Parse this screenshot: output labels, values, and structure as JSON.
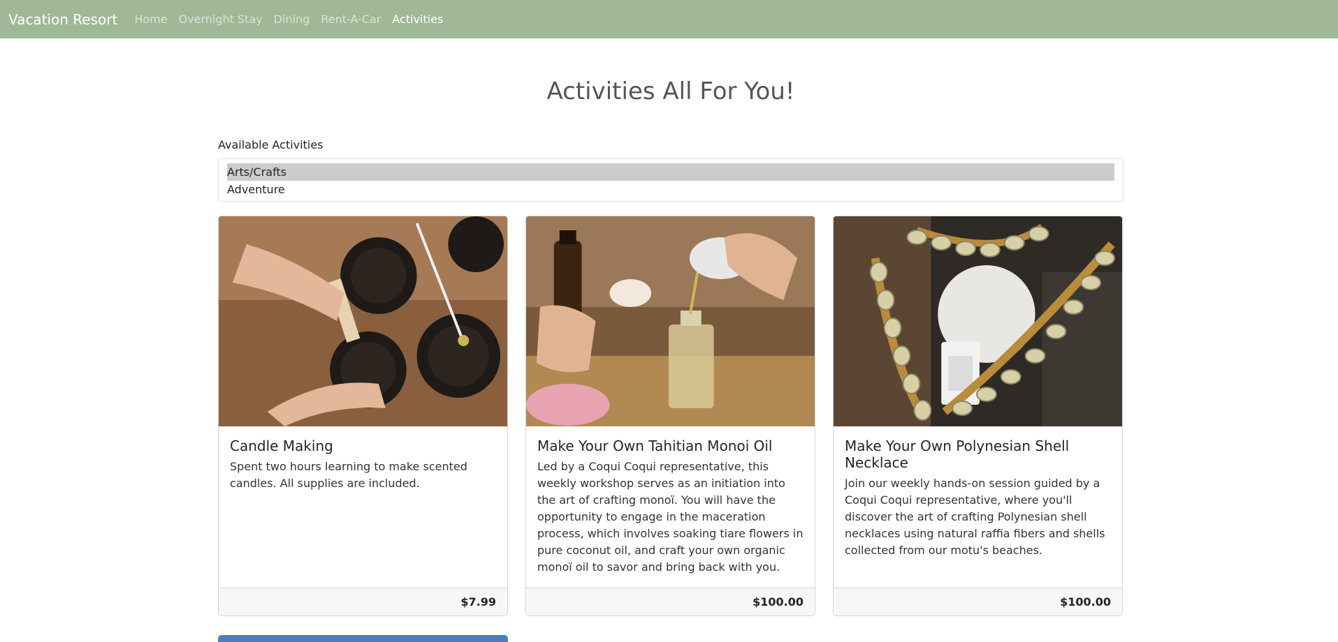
{
  "nav": {
    "brand": "Vacation Resort",
    "links": [
      "Home",
      "Overnight Stay",
      "Dining",
      "Rent-A-Car",
      "Activities"
    ]
  },
  "main": {
    "title": "Activities All For You!",
    "select_label": "Available Activities",
    "options": [
      "Arts/Crafts",
      "Adventure"
    ],
    "selected": "Arts/Crafts"
  },
  "cards": [
    {
      "title": "Candle Making",
      "text": "Spent two hours learning to make scented candles. All supplies are included.",
      "price": "$7.99"
    },
    {
      "title": "Make Your Own Tahitian Monoi Oil",
      "text": "Led by a Coqui Coqui representative, this weekly workshop serves as an initiation into the art of crafting monoï. You will have the opportunity to engage in the maceration process, which involves soaking tiare flowers in pure coconut oil, and craft your own organic monoï oil to savor and bring back with you.",
      "price": "$100.00"
    },
    {
      "title": "Make Your Own Polynesian Shell Necklace",
      "text": "Join our weekly hands-on session guided by a Coqui Coqui representative, where you'll discover the art of crafting Polynesian shell necklaces using natural raffia fibers and shells collected from our motu's beaches.",
      "price": "$100.00"
    }
  ],
  "colors": {
    "navbar": "#a1b897",
    "selected_option": "#cccccc"
  }
}
